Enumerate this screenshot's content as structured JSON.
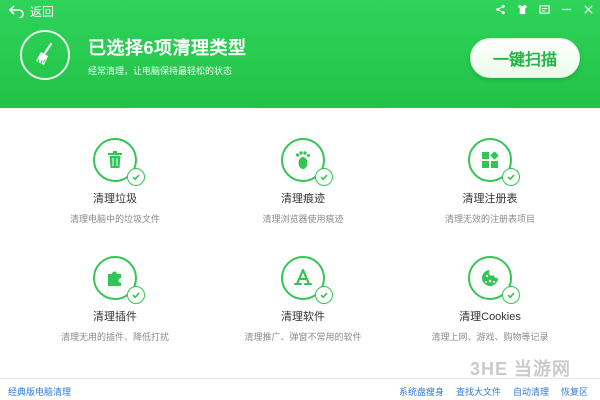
{
  "header": {
    "back_label": "返回",
    "title": "已选择6项清理类型",
    "subtitle": "经常清理，让电脑保持最轻松的状态",
    "scan_button": "一键扫描",
    "brush_icon": "broom-icon",
    "controls": [
      "share-icon",
      "shirt-icon",
      "menu-icon",
      "minimize-icon",
      "close-icon"
    ]
  },
  "items": [
    {
      "title": "清理垃圾",
      "desc": "清理电脑中的垃圾文件",
      "icon": "trash-icon",
      "checked": true
    },
    {
      "title": "清理痕迹",
      "desc": "清理浏览器使用痕迹",
      "icon": "footprint-icon",
      "checked": true
    },
    {
      "title": "清理注册表",
      "desc": "清理无效的注册表项目",
      "icon": "registry-blocks-icon",
      "checked": true
    },
    {
      "title": "清理插件",
      "desc": "清理无用的插件、降低打扰",
      "icon": "puzzle-icon",
      "checked": true
    },
    {
      "title": "清理软件",
      "desc": "清理推广、弹窗不常用的软件",
      "icon": "app-store-icon",
      "checked": true
    },
    {
      "title": "清理Cookies",
      "desc": "清理上网、游戏、购物等记录",
      "icon": "cookie-icon",
      "checked": true
    }
  ],
  "footer": {
    "left_link": "经典版电脑清理",
    "links": [
      "系统盘瘦身",
      "查找大文件",
      "自动清理",
      "恢复区"
    ]
  },
  "watermark": "3HE 当游网",
  "colors": {
    "accent": "#2fd35a",
    "accent_dark": "#22c247",
    "link": "#2e7ad6"
  }
}
